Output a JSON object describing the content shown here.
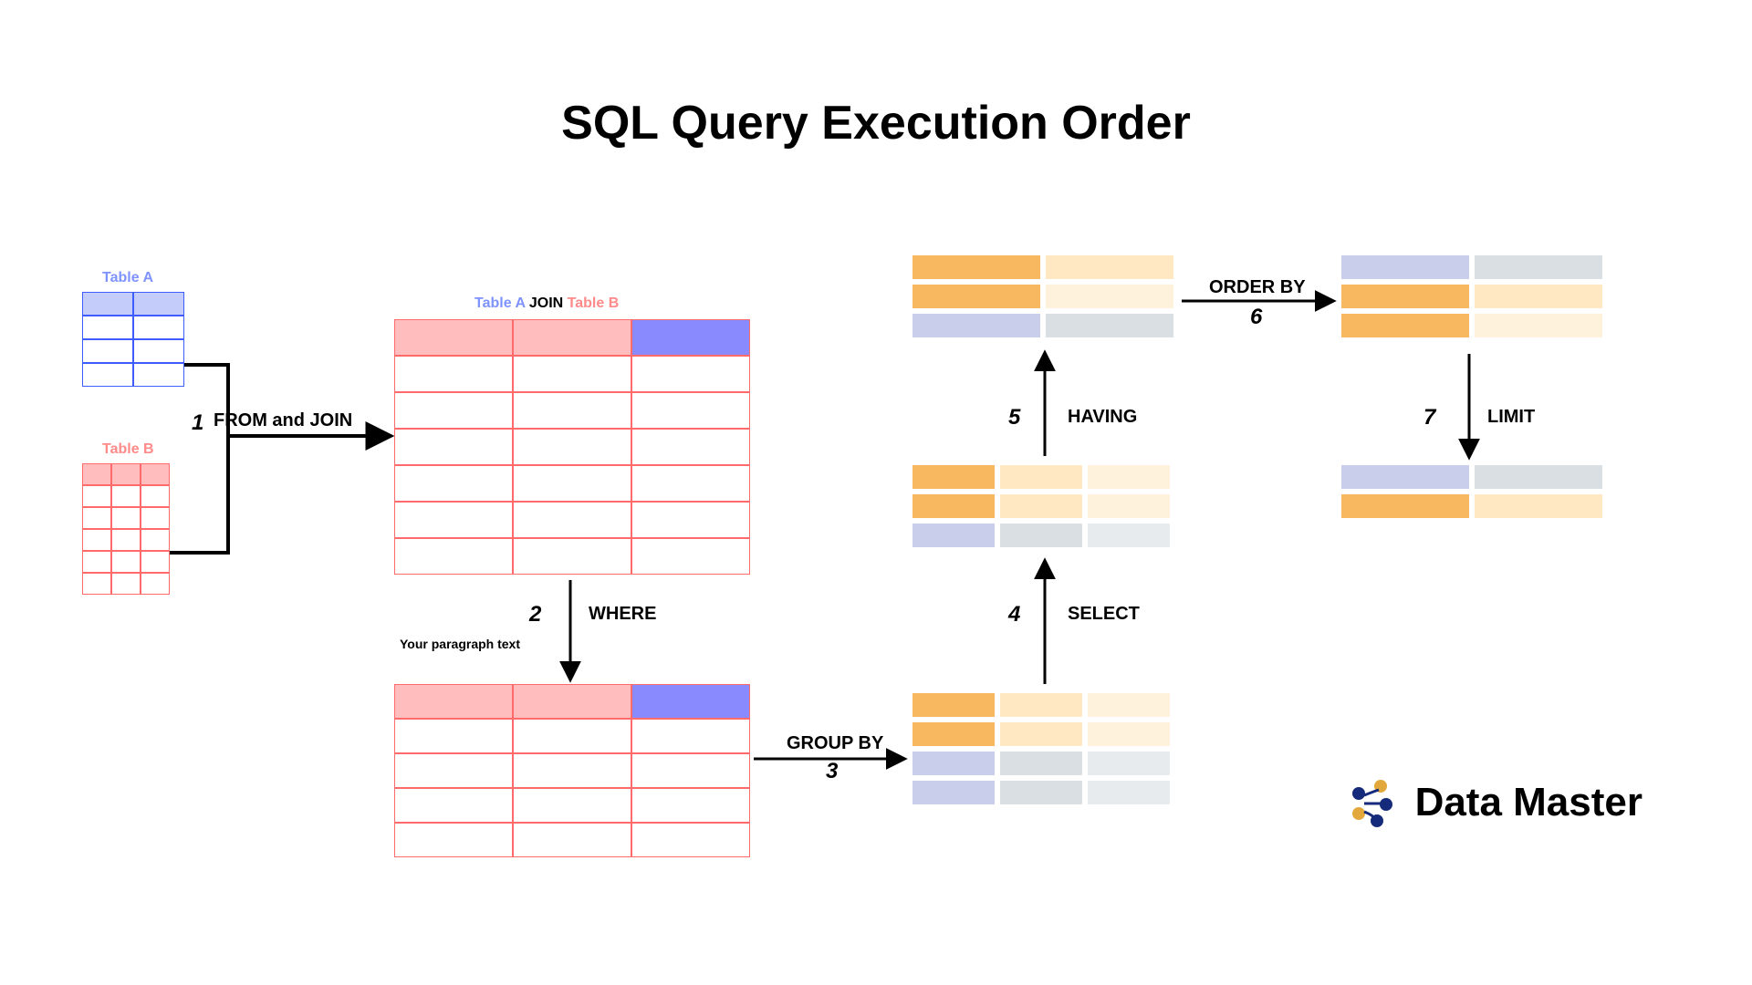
{
  "title": "SQL Query Execution Order",
  "tables": {
    "a_label": "Table A",
    "b_label": "Table B",
    "join_a": "Table A",
    "join_mid": " JOIN ",
    "join_b": "Table B"
  },
  "steps": {
    "s1_num": "1",
    "s1_label": "FROM and JOIN",
    "s2_num": "2",
    "s2_label": "WHERE",
    "s2_caption": "Your paragraph text",
    "s3_num": "3",
    "s3_label": "GROUP BY",
    "s4_num": "4",
    "s4_label": "SELECT",
    "s5_num": "5",
    "s5_label": "HAVING",
    "s6_num": "6",
    "s6_label": "ORDER BY",
    "s7_num": "7",
    "s7_label": "LIMIT"
  },
  "brand": "Data Master",
  "colors": {
    "blue": "#3f5cff",
    "red": "#ff6b6b",
    "orange": "#f7b860",
    "lavender": "#c9ceeb",
    "navy": "#152a7a",
    "gold": "#e2a83c"
  }
}
